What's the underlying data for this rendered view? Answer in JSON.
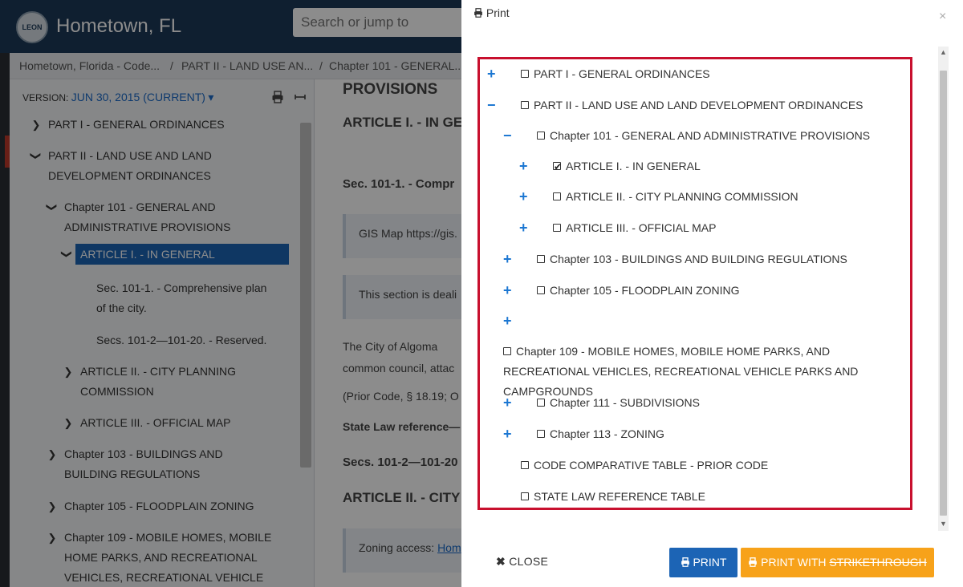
{
  "header": {
    "seal_text": "LEON",
    "site_title": "Hometown, FL",
    "search_placeholder": "Search or jump to"
  },
  "breadcrumb": [
    "Hometown, Florida - Code...",
    "/",
    "PART II - LAND USE AN...",
    "/",
    "Chapter 101 - GENERAL..."
  ],
  "sidebar": {
    "version_label": "VERSION:",
    "version_value": "JUN 30, 2015 (CURRENT)",
    "version_caret": "▾",
    "print_icon": "printer-icon",
    "collapse_icon": "collapse-icon",
    "items": [
      {
        "label": "PART I - GENERAL ORDINANCES",
        "chev": "❯"
      },
      {
        "label": "PART II - LAND USE AND LAND\nDEVELOPMENT ORDINANCES",
        "chev": "❮"
      },
      {
        "label": "Chapter 101 - GENERAL AND\nADMINISTRATIVE PROVISIONS",
        "chev": "❮"
      },
      {
        "label": "ARTICLE I. - IN GENERAL",
        "chev": "❮"
      },
      {
        "label": "Sec. 101-1. - Comprehensive plan\nof the city.",
        "chev": ""
      },
      {
        "label": "Secs. 101-2—101-20. - Reserved.",
        "chev": ""
      },
      {
        "label": "ARTICLE II. - CITY PLANNING\nCOMMISSION",
        "chev": "❯"
      },
      {
        "label": "ARTICLE III. - OFFICIAL MAP",
        "chev": "❯"
      },
      {
        "label": "Chapter 103 - BUILDINGS AND\nBUILDING REGULATIONS",
        "chev": "❯"
      },
      {
        "label": "Chapter 105 - FLOODPLAIN ZONING",
        "chev": "❯"
      },
      {
        "label": "Chapter 109 - MOBILE HOMES, MOBILE\nHOME PARKS, AND RECREATIONAL\nVEHICLES, RECREATIONAL VEHICLE",
        "chev": "❯"
      }
    ]
  },
  "content": {
    "heading_provisions": "PROVISIONS",
    "heading_article1": "ARTICLE I. - IN GE",
    "sec_heading": "Sec. 101-1. - Compr",
    "note_gis": "GIS Map https://gis.",
    "note_section": "This section is deali",
    "para1_line1": "The City of Algoma",
    "para1_line2": "common council, attac",
    "prior_code": "(Prior Code, § 18.19; O",
    "state_law": "State Law reference—",
    "secs_heading": "Secs. 101-2—101-20",
    "article2_heading": "ARTICLE II. - CITY",
    "zoning_prefix": "Zoning access: ",
    "zoning_link": "Hom"
  },
  "print_modal": {
    "title": "Print",
    "close_x": "×",
    "toc": [
      {
        "toggle": "+",
        "label": "PART I - GENERAL ORDINANCES",
        "checked": false
      },
      {
        "toggle": "−",
        "label": "PART II - LAND USE AND LAND DEVELOPMENT ORDINANCES",
        "checked": false
      },
      {
        "toggle": "−",
        "label": "Chapter 101 - GENERAL AND ADMINISTRATIVE PROVISIONS",
        "checked": false
      },
      {
        "toggle": "+",
        "label": "ARTICLE I. - IN GENERAL",
        "checked": true
      },
      {
        "toggle": "+",
        "label": "ARTICLE II. - CITY PLANNING COMMISSION",
        "checked": false
      },
      {
        "toggle": "+",
        "label": "ARTICLE III. - OFFICIAL MAP",
        "checked": false
      },
      {
        "toggle": "+",
        "label": "Chapter 103 - BUILDINGS AND BUILDING REGULATIONS",
        "checked": false
      },
      {
        "toggle": "+",
        "label": "Chapter 105 - FLOODPLAIN ZONING",
        "checked": false
      },
      {
        "toggle": "+",
        "label": "",
        "checked": false
      },
      {
        "toggle": "",
        "label": "Chapter 109 - MOBILE HOMES, MOBILE HOME PARKS, AND RECREATIONAL VEHICLES, RECREATIONAL VEHICLE PARKS AND CAMPGROUNDS",
        "checked": false
      },
      {
        "toggle": "+",
        "label": "Chapter 111 - SUBDIVISIONS",
        "checked": false
      },
      {
        "toggle": "+",
        "label": "Chapter 113 - ZONING",
        "checked": false
      },
      {
        "toggle": "",
        "label": "CODE COMPARATIVE TABLE - PRIOR CODE",
        "checked": false
      },
      {
        "toggle": "",
        "label": "STATE LAW REFERENCE TABLE",
        "checked": false
      }
    ],
    "close_button": "CLOSE",
    "print_button": "PRINT",
    "print_strike_prefix": "PRINT WITH ",
    "print_strike_word": "STRIKETHROUGH",
    "accent_red": "#c8102e",
    "primary_blue": "#1c64b5",
    "warning_orange": "#f7a21a"
  }
}
